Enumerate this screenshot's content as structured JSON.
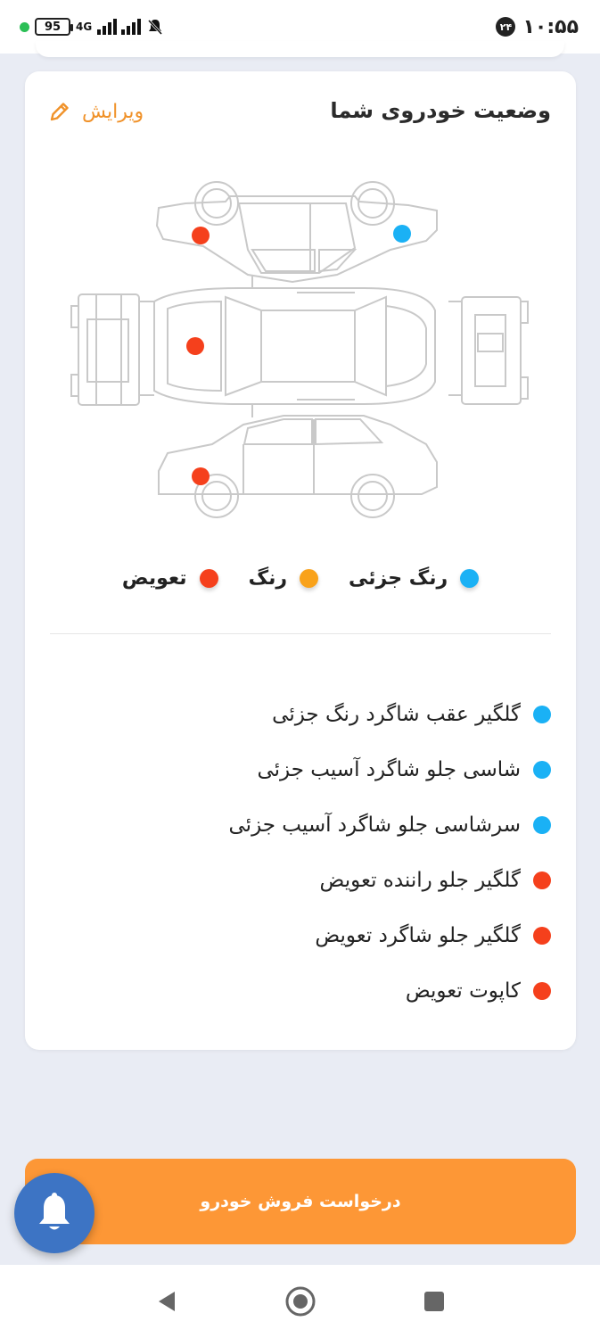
{
  "status_bar": {
    "battery": "95",
    "network": "4G",
    "notification_count": "۲۴",
    "time": "۱۰:۵۵"
  },
  "card": {
    "title": "وضعیت خودروی شما",
    "edit_label": "ویرایش"
  },
  "colors": {
    "partial_paint": "#1ab1f5",
    "paint": "#f9a21a",
    "replacement": "#f5401c",
    "accent": "#fd9736",
    "fab": "#3d74c4"
  },
  "legend": [
    {
      "label": "رنگ جزئی",
      "color": "#1ab1f5"
    },
    {
      "label": "رنگ",
      "color": "#f9a21a"
    },
    {
      "label": "تعویض",
      "color": "#f5401c"
    }
  ],
  "damages": [
    {
      "text": "گلگیر عقب شاگرد رنگ جزئی",
      "color": "#1ab1f5"
    },
    {
      "text": "شاسی جلو شاگرد آسیب جزئی",
      "color": "#1ab1f5"
    },
    {
      "text": "سرشاسی جلو شاگرد آسیب جزئی",
      "color": "#1ab1f5"
    },
    {
      "text": "گلگیر جلو راننده تعویض",
      "color": "#f5401c"
    },
    {
      "text": "گلگیر جلو شاگرد تعویض",
      "color": "#f5401c"
    },
    {
      "text": "کاپوت تعویض",
      "color": "#f5401c"
    }
  ],
  "diagram_markers": [
    {
      "part": "front-fender-passenger",
      "status": "replacement"
    },
    {
      "part": "rear-fender-passenger",
      "status": "partial_paint"
    },
    {
      "part": "hood",
      "status": "replacement"
    },
    {
      "part": "front-fender-driver",
      "status": "replacement"
    }
  ],
  "sell_button_label": "درخواست فروش خودرو",
  "icons": {
    "edit": "pencil-icon",
    "fab": "bell-icon",
    "nav_back": "triangle-back-icon",
    "nav_home": "circle-home-icon",
    "nav_recents": "square-recents-icon"
  }
}
